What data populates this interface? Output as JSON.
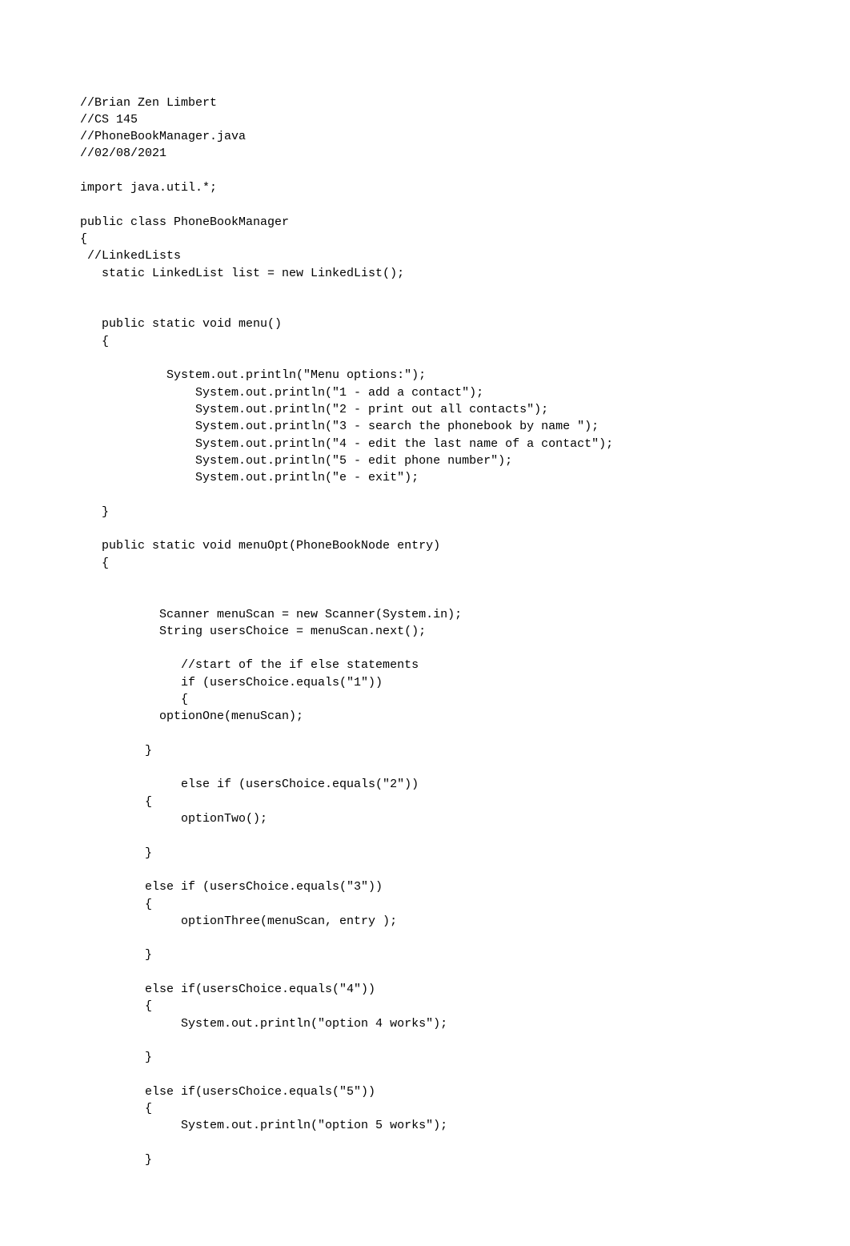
{
  "code": {
    "lines": [
      "//Brian Zen Limbert",
      "//CS 145",
      "//PhoneBookManager.java",
      "//02/08/2021",
      "",
      "import java.util.*;",
      "",
      "public class PhoneBookManager",
      "{",
      " //LinkedLists",
      "   static LinkedList list = new LinkedList();",
      "",
      "",
      "   public static void menu()",
      "   {",
      "",
      "            System.out.println(\"Menu options:\");",
      "                System.out.println(\"1 - add a contact\");",
      "                System.out.println(\"2 - print out all contacts\");",
      "                System.out.println(\"3 - search the phonebook by name \");",
      "                System.out.println(\"4 - edit the last name of a contact\");",
      "                System.out.println(\"5 - edit phone number\");",
      "                System.out.println(\"e - exit\");",
      "",
      "   }",
      "",
      "   public static void menuOpt(PhoneBookNode entry)",
      "   {",
      "",
      "",
      "           Scanner menuScan = new Scanner(System.in);",
      "           String usersChoice = menuScan.next();",
      "",
      "              //start of the if else statements",
      "              if (usersChoice.equals(\"1\"))",
      "              {",
      "           optionOne(menuScan);",
      "",
      "         }",
      "",
      "              else if (usersChoice.equals(\"2\"))",
      "         {",
      "              optionTwo();",
      "",
      "         }",
      "",
      "         else if (usersChoice.equals(\"3\"))",
      "         {",
      "              optionThree(menuScan, entry );",
      "",
      "         }",
      "",
      "         else if(usersChoice.equals(\"4\"))",
      "         {",
      "              System.out.println(\"option 4 works\");",
      "",
      "         }",
      "",
      "         else if(usersChoice.equals(\"5\"))",
      "         {",
      "              System.out.println(\"option 5 works\");",
      "",
      "         }"
    ]
  }
}
